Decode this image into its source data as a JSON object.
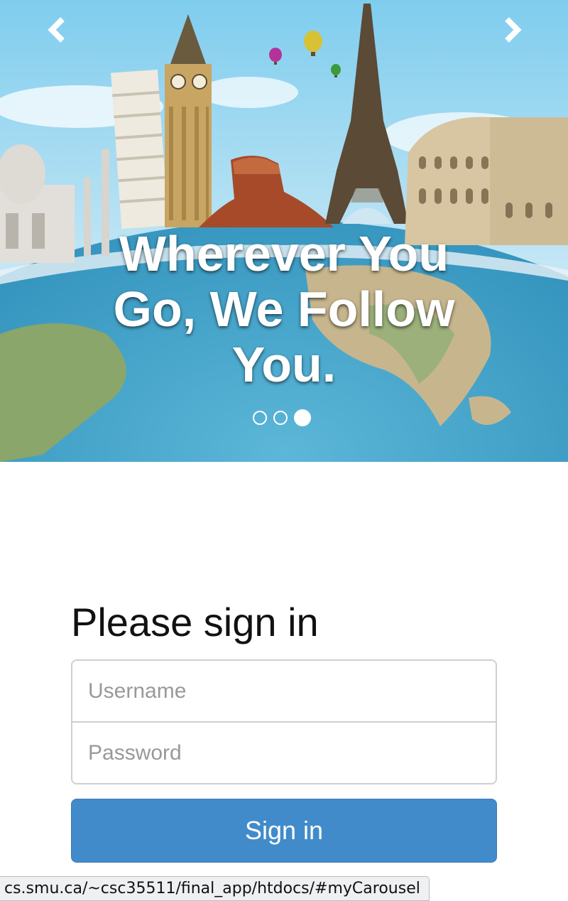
{
  "carousel": {
    "caption": "Wherever You Go, We Follow You.",
    "controls": {
      "prev_icon": "chevron-left-icon",
      "next_icon": "chevron-right-icon"
    },
    "indicators": {
      "count": 3,
      "active_index": 2
    },
    "image_description": "Travel landmarks on a globe: Taj Mahal, Leaning Tower of Pisa, Big Ben, Monument Valley butte, Eiffel Tower, Colosseum, hot air balloons"
  },
  "signin": {
    "heading": "Please sign in",
    "username_placeholder": "Username",
    "password_placeholder": "Password",
    "button_label": "Sign in",
    "button_color": "#428bca"
  },
  "status_bar": {
    "url": "cs.smu.ca/~csc35511/final_app/htdocs/#myCarousel"
  }
}
